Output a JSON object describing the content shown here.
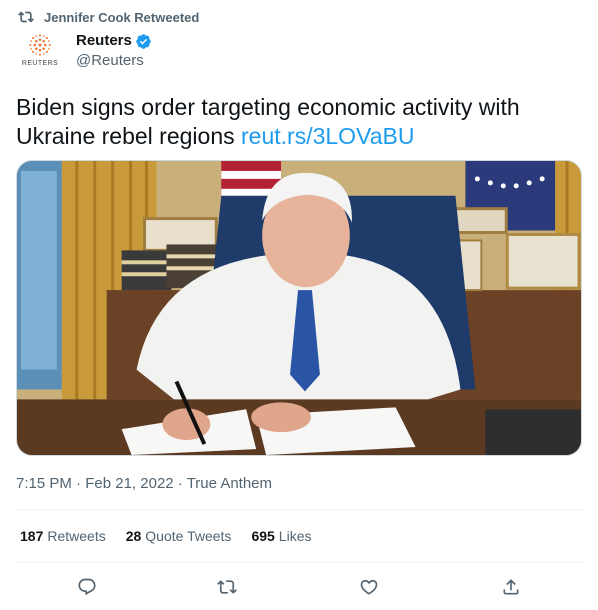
{
  "retweet": {
    "icon": "retweet-icon",
    "text": "Jennifer Cook Retweeted"
  },
  "author": {
    "avatar_icon": "reuters-logo-icon",
    "avatar_word": "REUTERS",
    "display_name": "Reuters",
    "verified_icon": "verified-badge-icon",
    "handle": "@Reuters"
  },
  "tweet": {
    "text": "Biden signs order targeting economic activity with Ukraine rebel regions ",
    "link": "reut.rs/3LOVaBU"
  },
  "media": {
    "description_icon": "photo-image"
  },
  "meta": {
    "time": "7:15 PM",
    "sep1": " · ",
    "date": "Feb 21, 2022",
    "sep2": " · ",
    "source": "True Anthem"
  },
  "stats": {
    "retweets_count": "187",
    "retweets_label": "Retweets",
    "quotes_count": "28",
    "quotes_label": "Quote Tweets",
    "likes_count": "695",
    "likes_label": "Likes"
  },
  "actions": [
    {
      "name": "reply-icon"
    },
    {
      "name": "retweet-icon"
    },
    {
      "name": "like-icon"
    },
    {
      "name": "share-icon"
    }
  ],
  "colors": {
    "text": "#0f1419",
    "secondary": "#536471",
    "link": "#1d9bf0",
    "reuters_orange": "#f26a21"
  }
}
